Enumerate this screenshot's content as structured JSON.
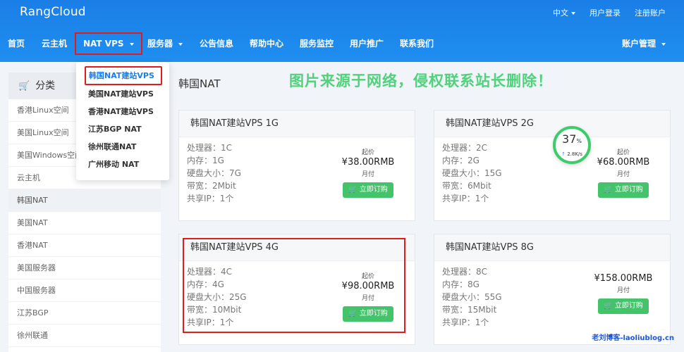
{
  "header": {
    "brand": "RangCloud",
    "language": "中文",
    "login": "用户登录",
    "register": "注册账户"
  },
  "nav": {
    "items": [
      "首页",
      "云主机",
      "NAT VPS",
      "服务器",
      "公告信息",
      "帮助中心",
      "服务监控",
      "用户推广",
      "联系我们"
    ],
    "account": "账户管理"
  },
  "dropdown": {
    "items": [
      "韩国NAT建站VPS",
      "美国NAT建站VPS",
      "香港NAT建站VPS",
      "江苏BGP NAT",
      "徐州联通NAT",
      "广州移动 NAT"
    ]
  },
  "sidebar": {
    "title": "分类",
    "items": [
      "香港Linux空间",
      "美国Linux空间",
      "美国Windows空间",
      "云主机",
      "韩国NAT",
      "美国NAT",
      "香港NAT",
      "美国服务器",
      "中国服务器",
      "江苏BGP",
      "徐州联通"
    ]
  },
  "main": {
    "title": "韩国NAT",
    "watermark": "图片来源于网络，侵权联系站长删除！"
  },
  "spec_labels": {
    "cpu": "处理器：",
    "ram": "内存：",
    "disk": "硬盘大小：",
    "bw": "带宽：",
    "ip": "共享IP："
  },
  "products": [
    {
      "name": "韩国NAT建站VPS 1G",
      "cpu": "1C",
      "ram": "1G",
      "disk": "7G",
      "bw": "2Mbit",
      "ip": "1个",
      "price_prefix": "起价",
      "price": "¥38.00RMB",
      "period": "月付",
      "button": "立即订购"
    },
    {
      "name": "韩国NAT建站VPS 2G",
      "cpu": "2C",
      "ram": "2G",
      "disk": "15G",
      "bw": "6Mbit",
      "ip": "1个",
      "price_prefix": "起价",
      "price": "¥68.00RMB",
      "period": "月付",
      "button": "立即订购"
    },
    {
      "name": "韩国NAT建站VPS 4G",
      "cpu": "4C",
      "ram": "4G",
      "disk": "25G",
      "bw": "10Mbit",
      "ip": "1个",
      "price_prefix": "起价",
      "price": "¥98.00RMB",
      "period": "月付",
      "button": "立即订购"
    },
    {
      "name": "韩国NAT建站VPS 8G",
      "cpu": "8C",
      "ram": "8G",
      "disk": "55G",
      "bw": "15Mbit",
      "ip": "1个",
      "price_prefix": "",
      "price": "¥158.00RMB",
      "period": "月付",
      "button": "立即订购"
    }
  ],
  "gauge": {
    "value": "37",
    "unit": "%",
    "speed": "2.8K/s"
  },
  "footer": {
    "watermark": "老刘博客-laoliublog.cn"
  },
  "colors": {
    "header": "#1f8ff0",
    "accent_red": "#e01c1c",
    "button_green": "#43c36a",
    "watermark_green": "#4ed27a"
  }
}
